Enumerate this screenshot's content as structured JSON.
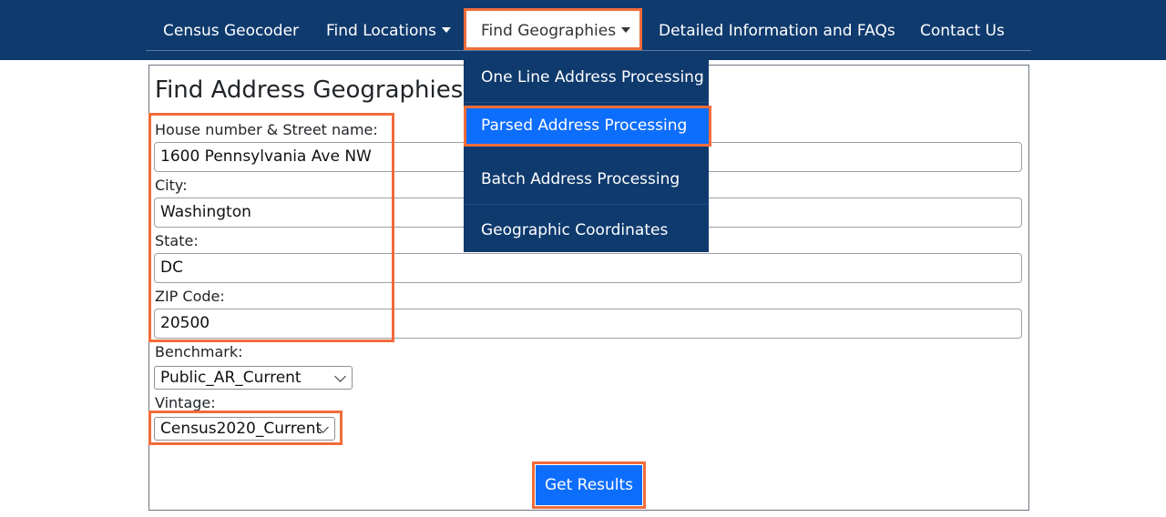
{
  "nav": {
    "items": [
      {
        "label": "Census Geocoder"
      },
      {
        "label": "Find Locations"
      },
      {
        "label": "Find Geographies"
      },
      {
        "label": "Detailed Information and FAQs"
      },
      {
        "label": "Contact Us"
      }
    ]
  },
  "dropdown": {
    "items": [
      {
        "label": "One Line Address Processing"
      },
      {
        "label": "Parsed Address Processing"
      },
      {
        "label": "Batch Address Processing"
      },
      {
        "label": "Geographic Coordinates"
      }
    ]
  },
  "form": {
    "title": "Find Address Geographies",
    "street_label": "House number & Street name:",
    "street_value": "1600 Pennsylvania Ave NW",
    "city_label": "City:",
    "city_value": "Washington",
    "state_label": "State:",
    "state_value": "DC",
    "zip_label": "ZIP Code:",
    "zip_value": "20500",
    "benchmark_label": "Benchmark:",
    "benchmark_value": "Public_AR_Current",
    "vintage_label": "Vintage:",
    "vintage_value": "Census2020_Current",
    "submit_label": "Get Results"
  },
  "colors": {
    "navbar": "#0f3a6e",
    "highlight": "#f26c3b",
    "primary_button": "#0d6efd"
  }
}
